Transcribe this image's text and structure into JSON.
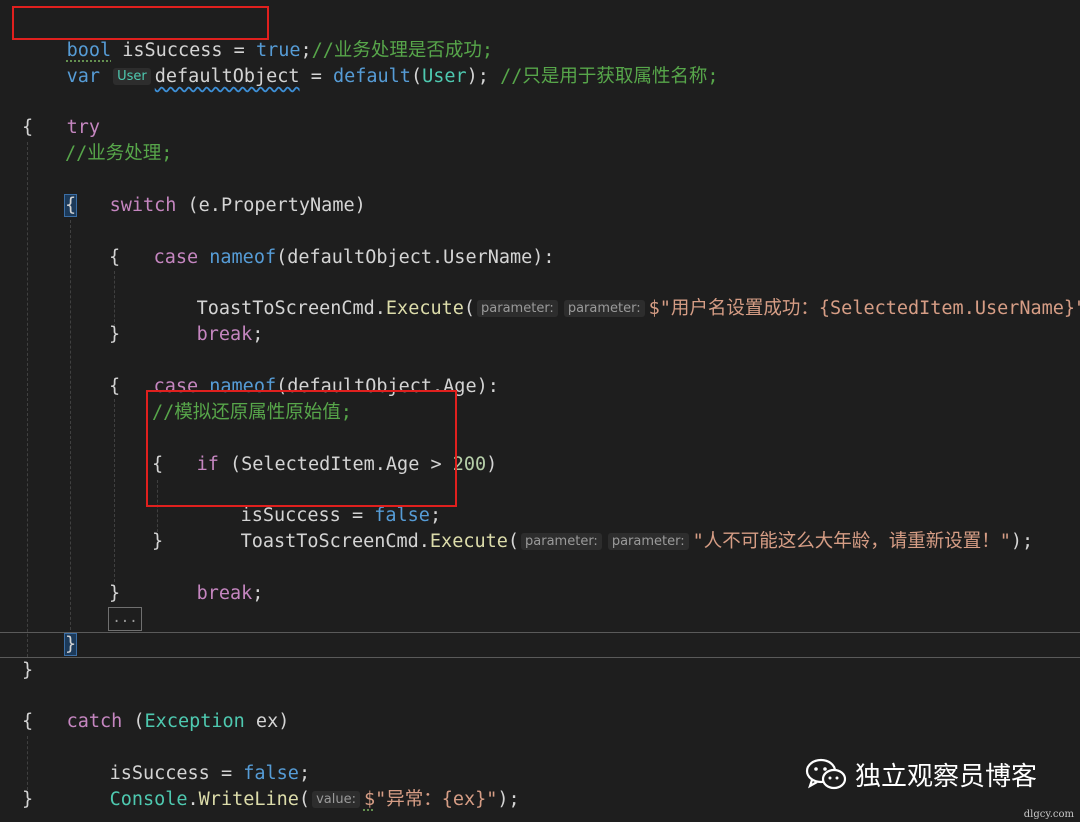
{
  "lines": {
    "l1": {
      "kw": "bool",
      "id": "isSuccess",
      "op": " = ",
      "val": "true",
      "semi": ";",
      "comment": "//业务处理是否成功;"
    },
    "l2": {
      "kw": "var",
      "hint": "User",
      "id": "defaultObject",
      "op": " = ",
      "fn": "default",
      "open": "(",
      "type": "User",
      "close": ");",
      "comment": " //只是用于获取属性名称;"
    },
    "l3": {
      "kw": "try"
    },
    "l4": {
      "brace": "{"
    },
    "l5": {
      "comment": "//业务处理;"
    },
    "l6": {
      "kw": "switch",
      "rest": " (e.PropertyName)"
    },
    "l7": {
      "brace": "{"
    },
    "l8": {
      "kw": "case",
      "fn": "nameof",
      "rest": "(defaultObject.UserName):"
    },
    "l9": {
      "brace": "{"
    },
    "l10": {
      "obj": "ToastToScreenCmd",
      "dot": ".",
      "fn": "Execute",
      "open": "(",
      "hint1": "parameter:",
      "hint2": "parameter:",
      "str": "$\"用户名设置成功：{SelectedItem.UserName}\"",
      "close": ");"
    },
    "l11": {
      "kw": "break",
      "semi": ";"
    },
    "l12": {
      "brace": "}"
    },
    "l13": {
      "kw": "case",
      "fn": "nameof",
      "rest": "(defaultObject.Age):"
    },
    "l14": {
      "brace": "{"
    },
    "l15": {
      "comment": "//模拟还原属性原始值;"
    },
    "l16": {
      "kw": "if",
      "rest": " (SelectedItem.Age > ",
      "num": "200",
      "close": ")"
    },
    "l17": {
      "brace": "{"
    },
    "l18": {
      "id": "isSuccess",
      "op": " = ",
      "val": "false",
      "semi": ";"
    },
    "l19": {
      "obj": "ToastToScreenCmd",
      "dot": ".",
      "fn": "Execute",
      "open": "(",
      "hint1": "parameter:",
      "hint2": "parameter:",
      "str": "\"人不可能这么大年龄，请重新设置！\"",
      "close": ");"
    },
    "l20": {
      "brace": "}"
    },
    "l21": {
      "kw": "break",
      "semi": ";"
    },
    "l22": {
      "brace": "}"
    },
    "l23": {
      "collapsed": "..."
    },
    "l24": {
      "brace": "}"
    },
    "l25": {
      "brace": "}"
    },
    "l26": {
      "kw": "catch",
      "open": " (",
      "type": "Exception",
      "rest": " ex)"
    },
    "l27": {
      "brace": "{"
    },
    "l28": {
      "id": "isSuccess",
      "op": " = ",
      "val": "false",
      "semi": ";"
    },
    "l29": {
      "type": "Console",
      "dot": ".",
      "fn": "WriteLine",
      "open": "(",
      "hint": "value:",
      "str_prefix": "$",
      "str": "\"异常：{ex}\"",
      "close": ");"
    },
    "l30": {
      "brace": "}"
    }
  },
  "watermark": {
    "text": "独立观察员博客",
    "icon": "wechat-icon",
    "site": "dlgcy.com"
  },
  "colors": {
    "background": "#1e1e1e",
    "keyword": "#569cd6",
    "control": "#c586c0",
    "type": "#4ec9b0",
    "method": "#dcdcaa",
    "comment": "#57a64a",
    "string": "#d69d85",
    "number": "#b5cea8",
    "highlight_box": "#e0201e"
  }
}
